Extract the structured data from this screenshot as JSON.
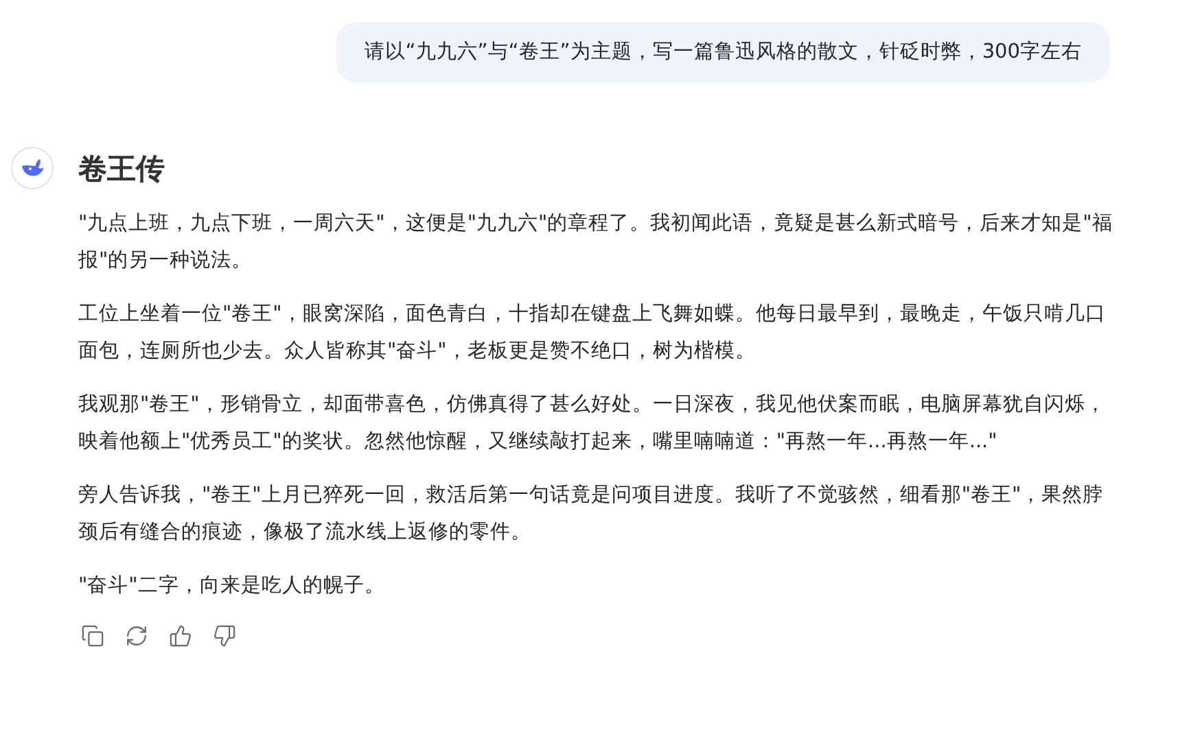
{
  "user_message": "请以“九九六”与“卷王”为主题，写一篇鲁迅风格的散文，针砭时弊，300字左右",
  "reply": {
    "title": "卷王传",
    "paragraphs": [
      "\"九点上班，九点下班，一周六天\"，这便是\"九九六\"的章程了。我初闻此语，竟疑是甚么新式暗号，后来才知是\"福报\"的另一种说法。",
      "工位上坐着一位\"卷王\"，眼窝深陷，面色青白，十指却在键盘上飞舞如蝶。他每日最早到，最晚走，午饭只啃几口面包，连厕所也少去。众人皆称其\"奋斗\"，老板更是赞不绝口，树为楷模。",
      "我观那\"卷王\"，形销骨立，却面带喜色，仿佛真得了甚么好处。一日深夜，我见他伏案而眠，电脑屏幕犹自闪烁，映着他额上\"优秀员工\"的奖状。忽然他惊醒，又继续敲打起来，嘴里喃喃道：\"再熬一年...再熬一年...\"",
      "旁人告诉我，\"卷王\"上月已猝死一回，救活后第一句话竟是问项目进度。我听了不觉骇然，细看那\"卷王\"，果然脖颈后有缝合的痕迹，像极了流水线上返修的零件。",
      "\"奋斗\"二字，向来是吃人的幌子。"
    ],
    "actions": [
      {
        "kind": "copy"
      },
      {
        "kind": "regenerate"
      },
      {
        "kind": "like"
      },
      {
        "kind": "dislike"
      }
    ]
  }
}
